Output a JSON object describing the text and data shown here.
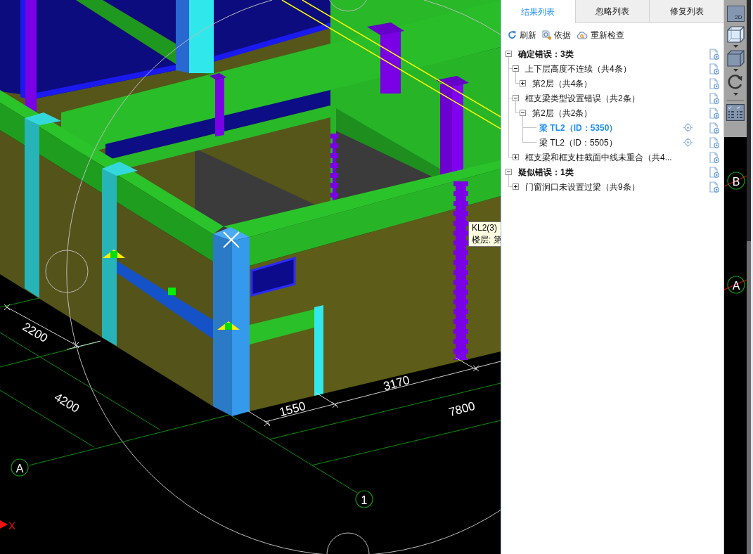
{
  "viewport": {
    "dimension_labels": [
      "2200",
      "4200",
      "1550",
      "3170",
      "7800"
    ],
    "grid_bubbles": [
      "A",
      "1"
    ],
    "axis_label": "X",
    "tooltip": {
      "lines": [
        "KL2(3)",
        "楼层: 第"
      ]
    }
  },
  "panel": {
    "tabs": [
      {
        "label": "结果列表",
        "selected": true
      },
      {
        "label": "忽略列表",
        "selected": false
      },
      {
        "label": "修复列表",
        "selected": false
      }
    ],
    "actions": [
      {
        "label": "刷新"
      },
      {
        "label": "依据"
      },
      {
        "label": "重新检查"
      }
    ],
    "tree": [
      {
        "kind": "group",
        "label": "确定错误：3类",
        "expanded": true,
        "selected": false,
        "children": [
          {
            "kind": "group",
            "label": "上下层高度不连续（共4条）",
            "expanded": true,
            "selected": false,
            "children": [
              {
                "kind": "group",
                "label": "第2层（共4条）",
                "expanded": false,
                "selected": false
              }
            ]
          },
          {
            "kind": "group",
            "label": "框支梁类型设置错误（共2条）",
            "expanded": true,
            "selected": false,
            "children": [
              {
                "kind": "group",
                "label": "第2层（共2条）",
                "expanded": true,
                "selected": false,
                "children": [
                  {
                    "kind": "item",
                    "label": "梁 TL2（ID：5350）",
                    "selected": true
                  },
                  {
                    "kind": "item",
                    "label": "梁 TL2（ID：5505）",
                    "selected": false
                  }
                ]
              }
            ]
          },
          {
            "kind": "group",
            "label": "框支梁和框支柱截面中线未重合（共4...",
            "expanded": false,
            "selected": false
          }
        ]
      },
      {
        "kind": "group",
        "label": "疑似错误：1类",
        "expanded": true,
        "selected": false,
        "children": [
          {
            "kind": "group",
            "label": "门窗洞口未设置过梁（共9条）",
            "expanded": false,
            "selected": false
          }
        ]
      }
    ]
  },
  "view_toolbar": {
    "mode_button": "2D"
  },
  "edge_grid_bubbles": [
    "B",
    "A"
  ]
}
